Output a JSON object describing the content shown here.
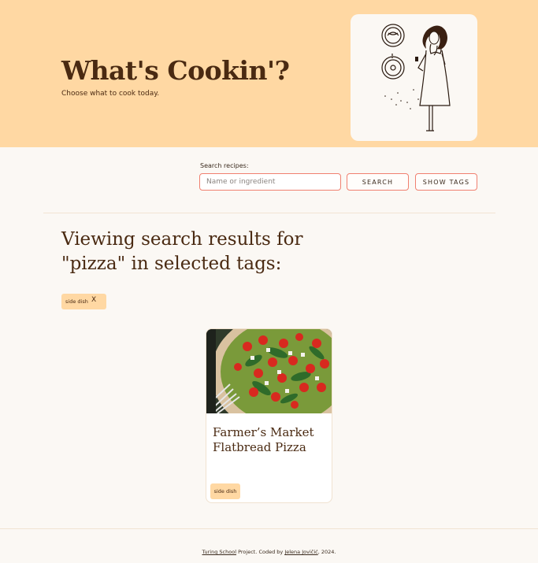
{
  "header": {
    "title": "What's Cookin'?",
    "subtitle": "Choose what to cook today."
  },
  "search": {
    "label": "Search recipes:",
    "placeholder": "Name or ingredient",
    "search_button": "SEARCH",
    "tags_button": "SHOW TAGS"
  },
  "results": {
    "heading": "Viewing search results for \"pizza\" in selected tags:",
    "selected_tags": [
      {
        "label": "side dish",
        "remove": "X"
      }
    ]
  },
  "recipes": [
    {
      "title": "Farmer’s Market Flatbread Pizza",
      "tag": "side dish"
    }
  ],
  "footer": {
    "school_link": "Turing School",
    "text_middle": " Project. Coded by ",
    "author_link": "Jelena Jovičić",
    "text_end": ", 2024."
  },
  "colors": {
    "header_bg": "#ffd8a3",
    "page_bg": "#fbf8f4",
    "accent_border": "#f08070",
    "text_dark": "#4a2a12"
  }
}
